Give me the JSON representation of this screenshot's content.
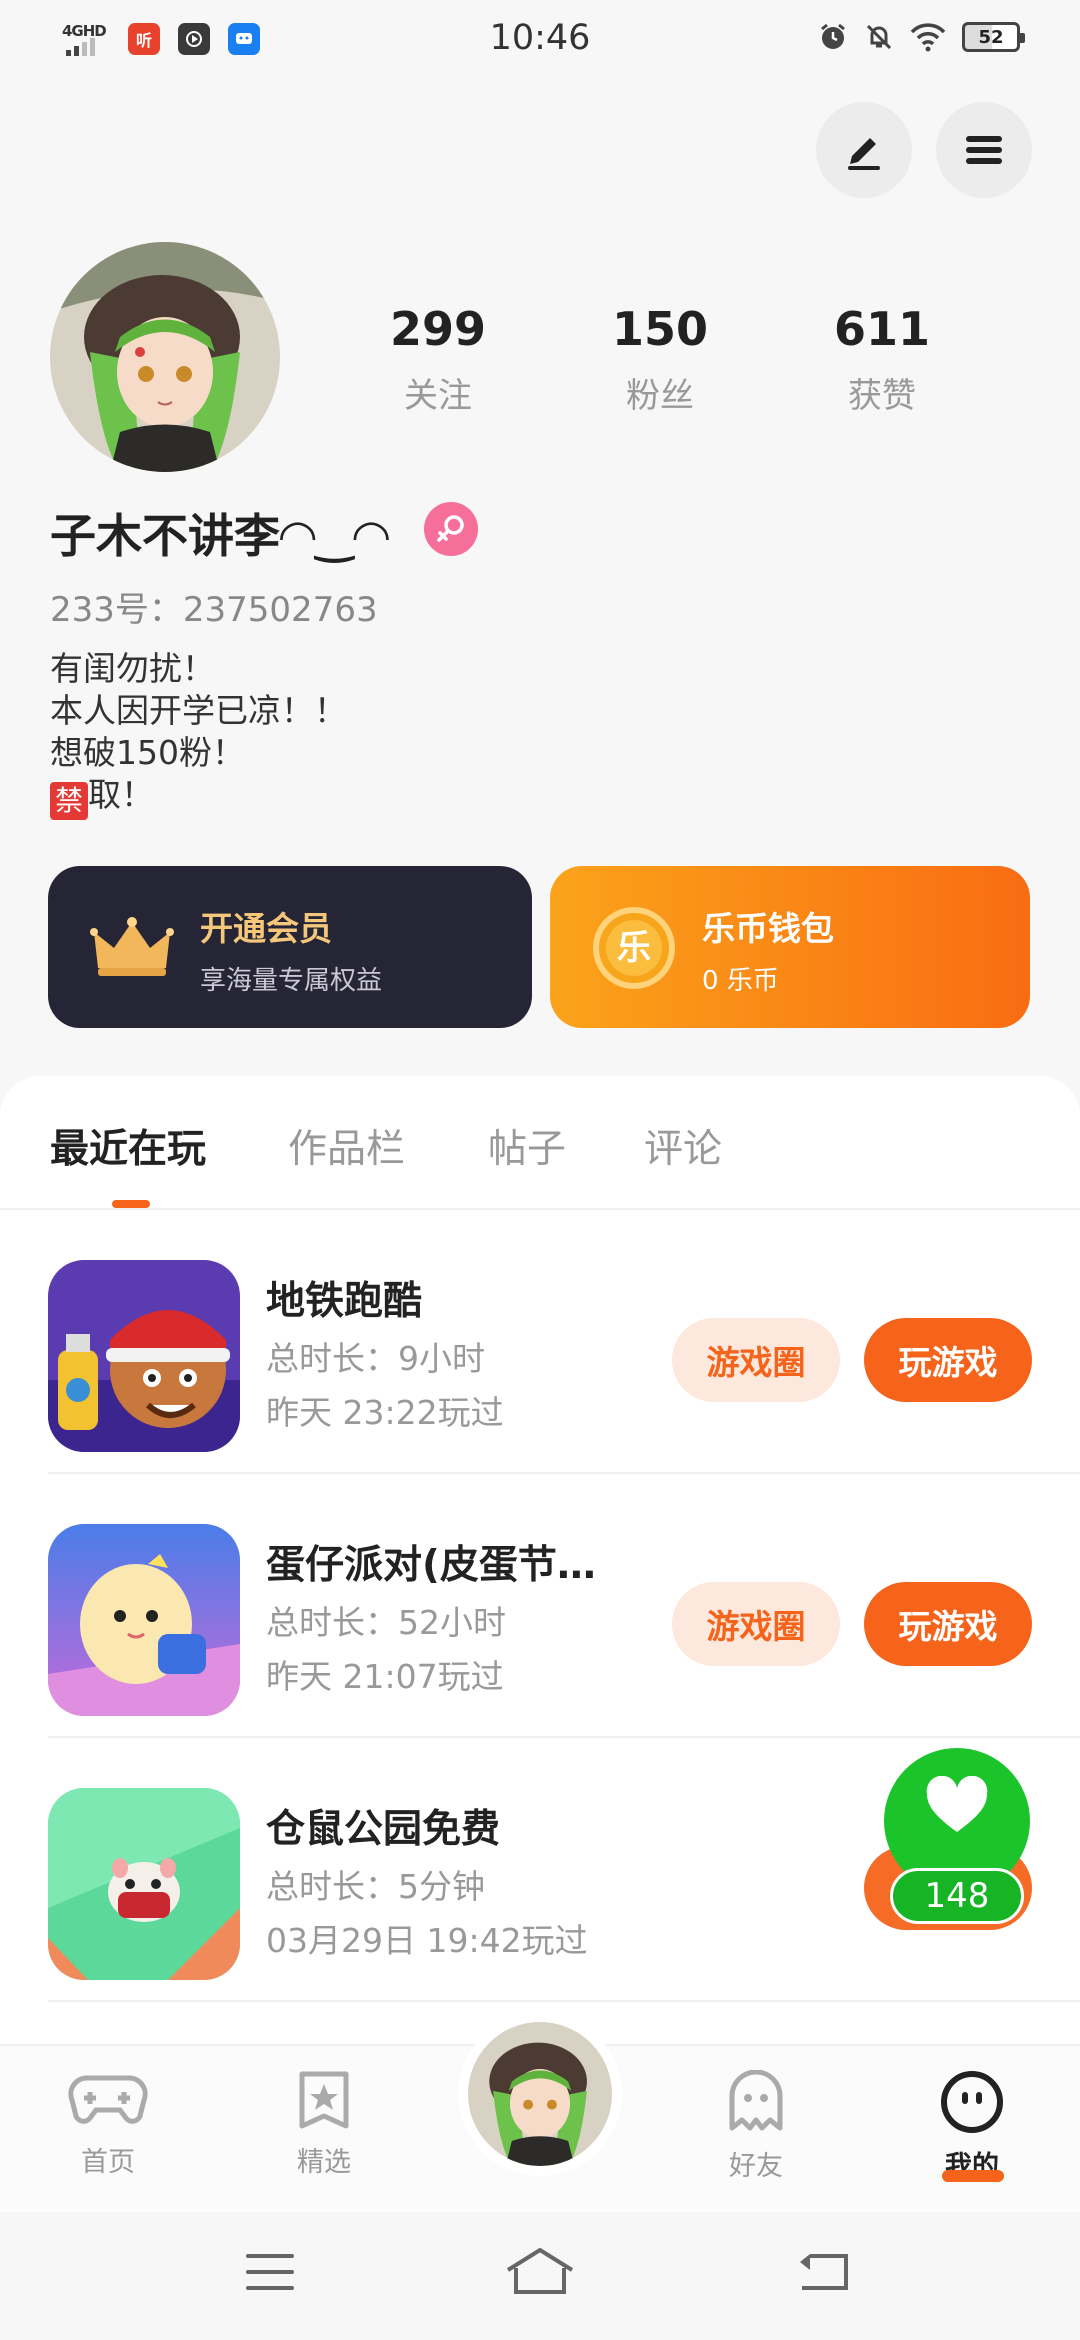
{
  "status_bar": {
    "network": "4GHD",
    "time": "10:46",
    "battery": "52"
  },
  "profile": {
    "following_count": "299",
    "following_label": "关注",
    "followers_count": "150",
    "followers_label": "粉丝",
    "likes_count": "611",
    "likes_label": "获赞",
    "nickname": "子木不讲李◠‿◠",
    "uid": "233号：237502763",
    "bio_line1": "有闺勿扰！",
    "bio_line2": "本人因开学已凉！！",
    "bio_line3": "想破150粉！",
    "bio_line4_badge": "禁",
    "bio_line4_text": "取！"
  },
  "cards": {
    "vip_title": "开通会员",
    "vip_subtitle": "享海量专属权益",
    "wallet_title": "乐币钱包",
    "wallet_subtitle": "0 乐币",
    "wallet_coin_char": "乐"
  },
  "tabs": [
    "最近在玩",
    "作品栏",
    "帖子",
    "评论"
  ],
  "games": [
    {
      "name": "地铁跑酷",
      "duration": "总时长：9小时",
      "last_played": "昨天 23:22玩过",
      "circle_label": "游戏圈",
      "play_label": "玩游戏"
    },
    {
      "name": "蛋仔派对(皮蛋节…",
      "duration": "总时长：52小时",
      "last_played": "昨天 21:07玩过",
      "circle_label": "游戏圈",
      "play_label": "玩游戏"
    },
    {
      "name": "仓鼠公园免费",
      "duration": "总时长：5分钟",
      "last_played": "03月29日 19:42玩过"
    }
  ],
  "like_float": {
    "count": "148"
  },
  "bottom_nav": {
    "home": "首页",
    "featured": "精选",
    "friends": "好友",
    "mine": "我的"
  },
  "colors": {
    "accent": "#f5641a",
    "vip_bg": "#262535",
    "like_green": "#1bc42a"
  }
}
